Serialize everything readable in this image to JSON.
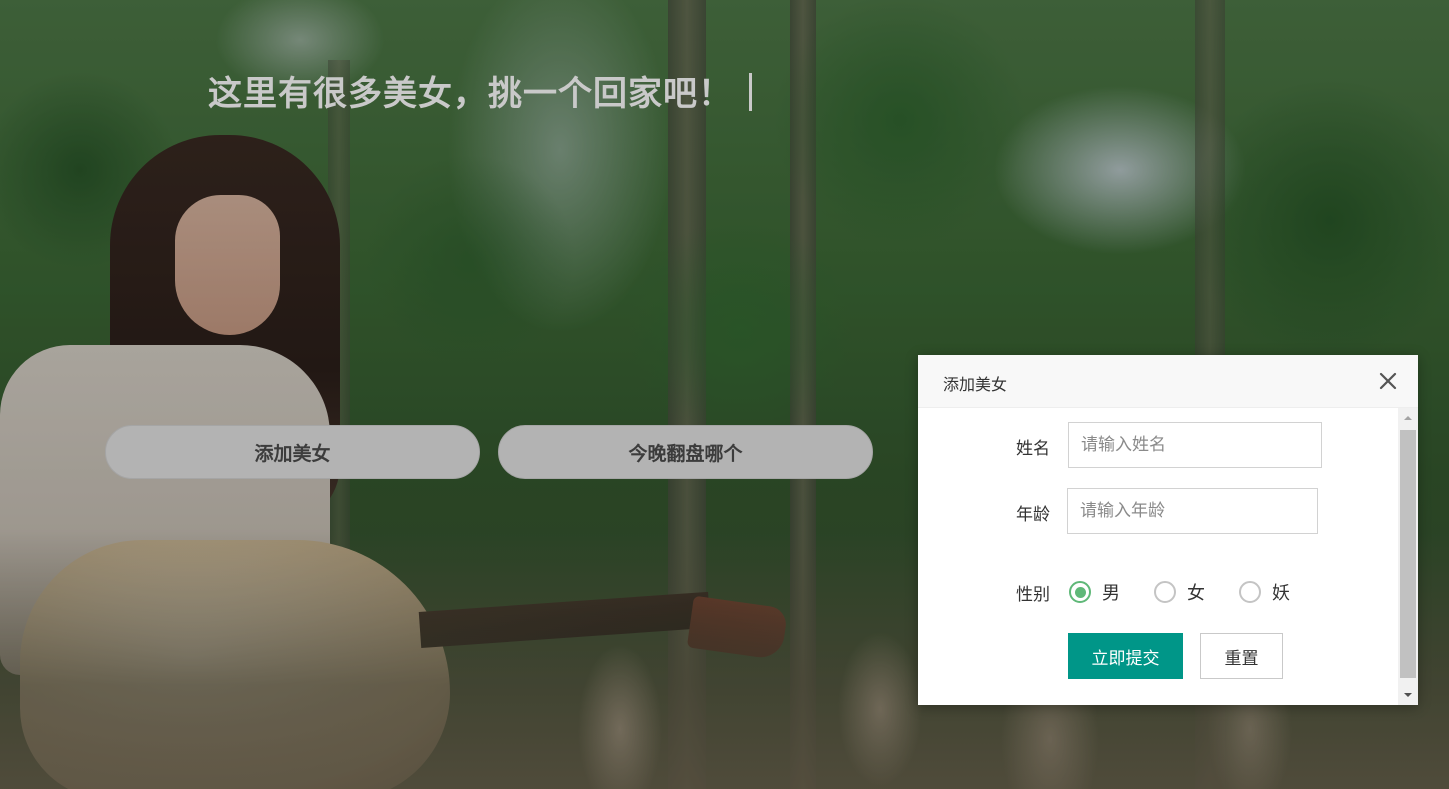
{
  "page": {
    "headline": "这里有很多美女，挑一个回家吧！",
    "buttons": {
      "add": "添加美女",
      "pick": "今晚翻盘哪个"
    }
  },
  "dialog": {
    "title": "添加美女",
    "close_icon": "close-icon",
    "fields": {
      "name": {
        "label": "姓名",
        "placeholder": "请输入姓名",
        "value": ""
      },
      "age": {
        "label": "年龄",
        "placeholder": "请输入年龄",
        "value": ""
      }
    },
    "gender": {
      "label": "性别",
      "options": [
        "男",
        "女",
        "妖"
      ],
      "selected": "男"
    },
    "submit_label": "立即提交",
    "reset_label": "重置"
  },
  "colors": {
    "primary_button": "#009688",
    "radio_selected": "#5fb878",
    "pill_button": "#b3b3b3"
  }
}
